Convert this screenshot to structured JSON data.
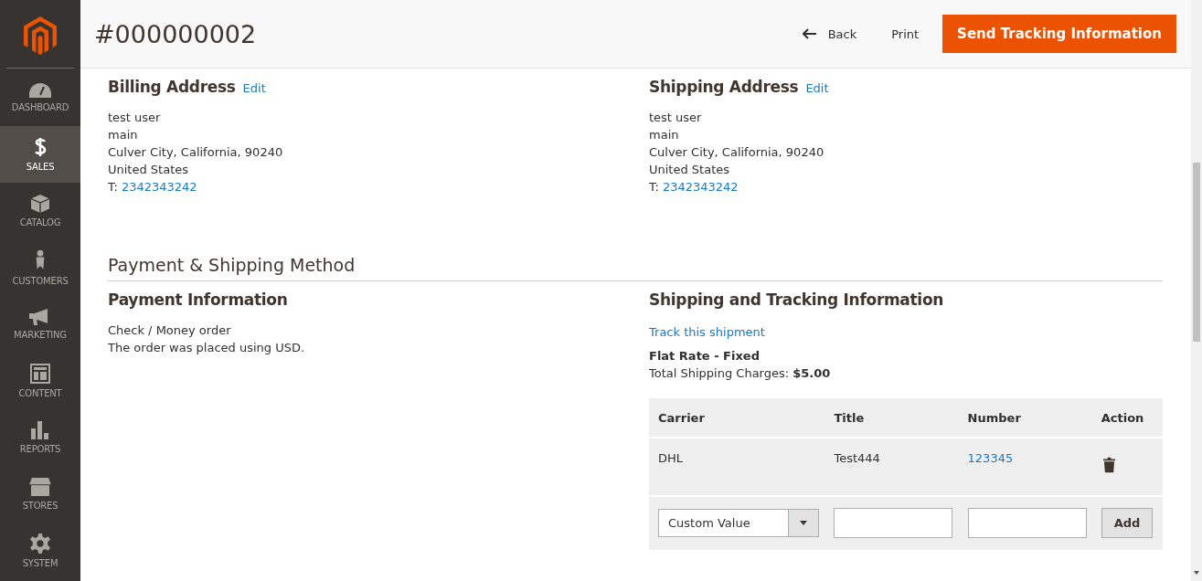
{
  "sidebar": {
    "items": [
      {
        "label": "DASHBOARD",
        "kind": "dashboard",
        "selected": false
      },
      {
        "label": "SALES",
        "kind": "sales",
        "selected": true
      },
      {
        "label": "CATALOG",
        "kind": "catalog",
        "selected": false
      },
      {
        "label": "CUSTOMERS",
        "kind": "customers",
        "selected": false
      },
      {
        "label": "MARKETING",
        "kind": "marketing",
        "selected": false
      },
      {
        "label": "CONTENT",
        "kind": "content",
        "selected": false
      },
      {
        "label": "REPORTS",
        "kind": "reports",
        "selected": false
      },
      {
        "label": "STORES",
        "kind": "stores",
        "selected": false
      },
      {
        "label": "SYSTEM",
        "kind": "system",
        "selected": false
      }
    ]
  },
  "header": {
    "title": "#000000002",
    "actions": [
      {
        "label": "Back",
        "kind": "back"
      },
      {
        "label": "Print",
        "kind": "link"
      },
      {
        "label": "Send Tracking Information",
        "kind": "primary"
      }
    ]
  },
  "addresses": [
    {
      "title": "Billing Address",
      "edit": "Edit",
      "lines": [
        "test user",
        "main",
        "Culver City, California, 90240",
        "United States"
      ],
      "phone_label": "T:",
      "phone": "2342343242"
    },
    {
      "title": "Shipping Address",
      "edit": "Edit",
      "lines": [
        "test user",
        "main",
        "Culver City, California, 90240",
        "United States"
      ],
      "phone_label": "T:",
      "phone": "2342343242"
    }
  ],
  "section_title": "Payment & Shipping Method",
  "payment": {
    "title": "Payment Information",
    "lines": [
      "Check / Money order",
      "The order was placed using USD."
    ]
  },
  "shipping": {
    "title": "Shipping and Tracking Information",
    "track_link": "Track this shipment",
    "method": "Flat Rate - Fixed",
    "charges": "Total Shipping Charges: **$5.00**"
  },
  "tracking_table": {
    "columns": [
      "Carrier",
      "Title",
      "Number",
      "Action"
    ],
    "rows": [
      {
        "carrier": "DHL",
        "title": "Test444",
        "number": "123345"
      }
    ],
    "new_row": {
      "carrier": "Custom Value",
      "button": "Add"
    }
  }
}
